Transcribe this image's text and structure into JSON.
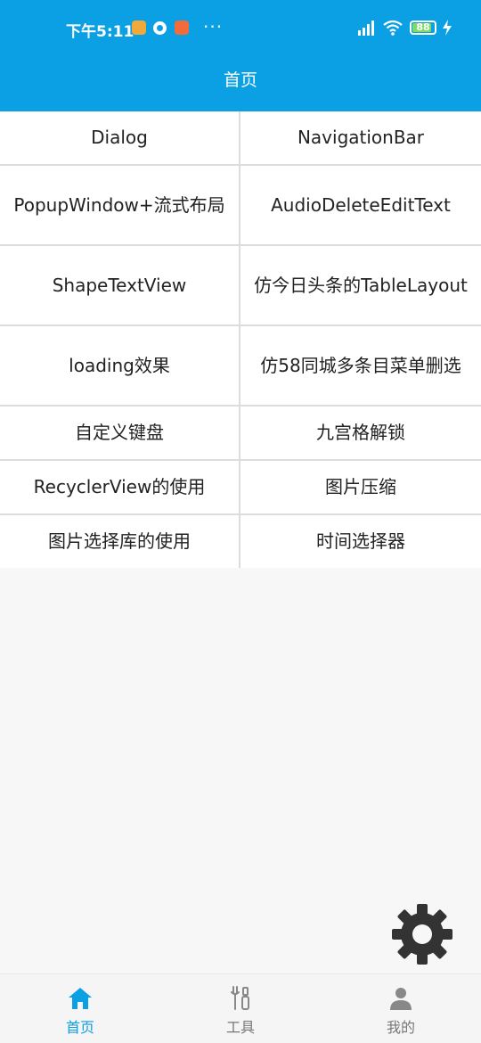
{
  "status_bar": {
    "time": "下午5:11",
    "more": "···",
    "battery_level": "88",
    "battery_fraction": 0.88
  },
  "header": {
    "title": "首页",
    "color": "#0aa0e3"
  },
  "grid": {
    "items": [
      "Dialog",
      "NavigationBar",
      "PopupWindow+流式布局",
      "AudioDeleteEditText",
      "ShapeTextView",
      "仿今日头条的TableLayout",
      "loading效果",
      "仿58同城多条目菜单删选",
      "自定义键盘",
      "九宫格解锁",
      "RecyclerView的使用",
      "图片压缩",
      "图片选择库的使用",
      "时间选择器"
    ]
  },
  "fab": {
    "icon": "gear-icon"
  },
  "bottom_nav": {
    "items": [
      {
        "label": "首页",
        "icon": "home-icon",
        "active": true
      },
      {
        "label": "工具",
        "icon": "tools-icon",
        "active": false
      },
      {
        "label": "我的",
        "icon": "person-icon",
        "active": false
      }
    ]
  }
}
